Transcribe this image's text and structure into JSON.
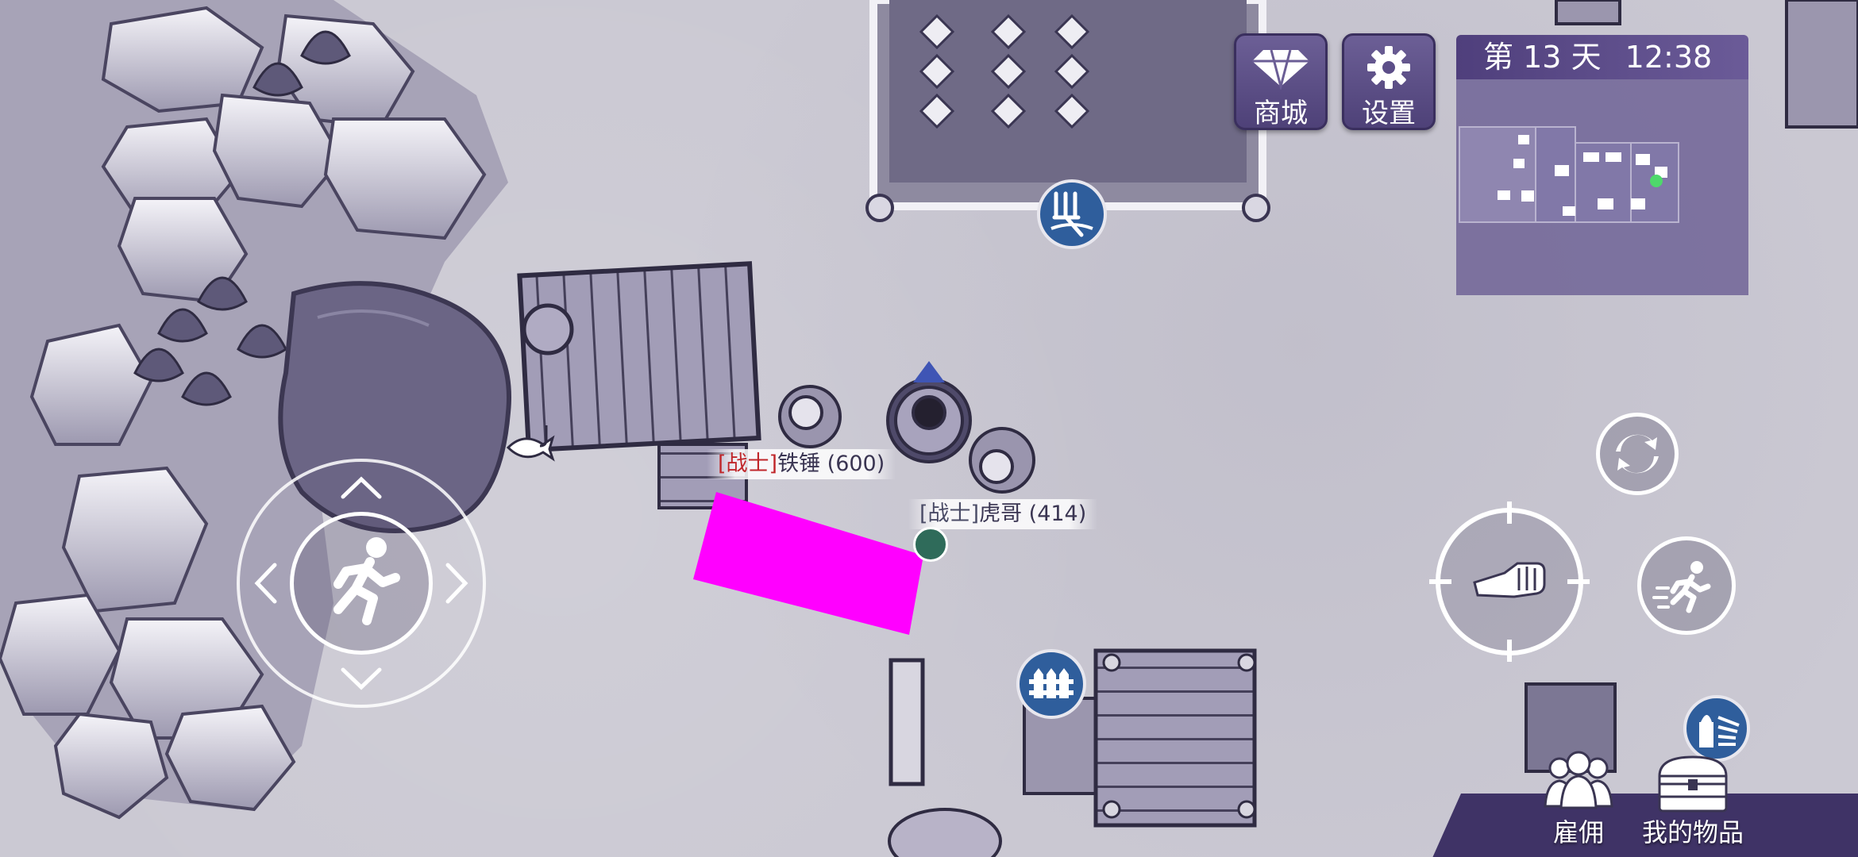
{
  "hud": {
    "shop_label": "商城",
    "settings_label": "设置",
    "day_prefix": "第",
    "day_number": "13",
    "day_suffix": "天",
    "clock": "12:38"
  },
  "characters": [
    {
      "role": "[战士]",
      "name": "铁锤",
      "level": "(600)",
      "role_color": "#c0262a"
    },
    {
      "role": "[战士]",
      "name": "虎哥",
      "level": "(414)",
      "role_color": "#4a4b66"
    }
  ],
  "bottom_menu": {
    "hire_label": "雇佣",
    "items_label": "我的物品"
  },
  "icons": {
    "shop": "diamond-icon",
    "settings": "gear-icon",
    "joystick": "running-man-icon",
    "refresh": "refresh-arrows-icon",
    "attack": "fist-icon",
    "sprint": "sprint-icon",
    "farm": "pitchfork-icon",
    "fence": "fence-icon",
    "fishing": "fish-hook-icon",
    "crafting": "crafting-tools-icon",
    "hire": "people-icon",
    "inventory": "chest-icon"
  },
  "colors": {
    "hud_purple": "#5a4c86",
    "name_highlight": "#c0262a",
    "marker_magenta": "#ff00ff"
  }
}
